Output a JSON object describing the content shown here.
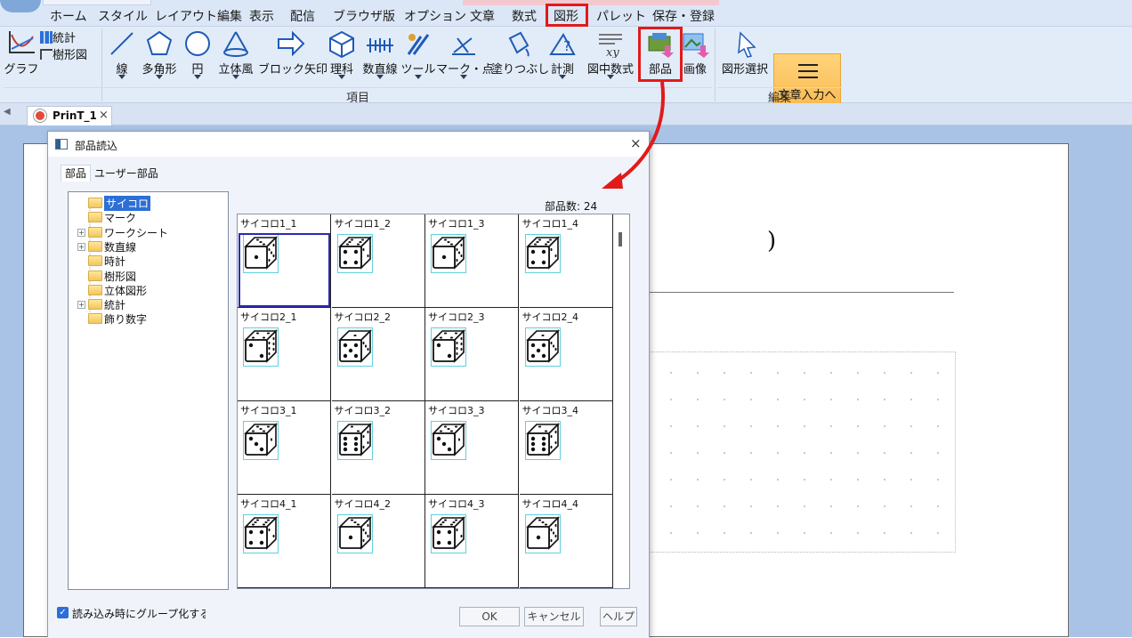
{
  "menubar": {
    "items": [
      "ホーム",
      "スタイル",
      "レイアウト編集",
      "表示",
      "配信",
      "ブラウザ版",
      "オプション",
      "文章",
      "数式",
      "図形",
      "パレット",
      "保存・登録"
    ],
    "highlighted": "図形",
    "highlight_color": "#e21a1a"
  },
  "ribbon": {
    "graph_label": "グラフ",
    "stats_label": "統計",
    "tree_label": "樹形図",
    "buttons": [
      "線",
      "多角形",
      "円",
      "立体風",
      "ブロック矢印",
      "理科",
      "数直線",
      "ツール",
      "マーク・点",
      "塗りつぶし",
      "計測",
      "図中数式",
      "部品",
      "画像",
      "図形選択",
      "文章入力へ"
    ],
    "group_items_label": "項目",
    "group_edit_label": "編集",
    "highlighted_button": "部品"
  },
  "doctab": {
    "title": "PrinT_1",
    "close": "×"
  },
  "document": {
    "paren": ")"
  },
  "dialog": {
    "title": "部品読込",
    "close": "×",
    "tabs": [
      "部品",
      "ユーザー部品"
    ],
    "tree": [
      {
        "label": "サイコロ",
        "selected": true,
        "expandable": false
      },
      {
        "label": "マーク",
        "selected": false,
        "expandable": false
      },
      {
        "label": "ワークシート",
        "selected": false,
        "expandable": true
      },
      {
        "label": "数直線",
        "selected": false,
        "expandable": true
      },
      {
        "label": "時計",
        "selected": false,
        "expandable": false
      },
      {
        "label": "樹形図",
        "selected": false,
        "expandable": false
      },
      {
        "label": "立体図形",
        "selected": false,
        "expandable": false
      },
      {
        "label": "統計",
        "selected": false,
        "expandable": true
      },
      {
        "label": "飾り数字",
        "selected": false,
        "expandable": false
      }
    ],
    "count_label": "部品数:",
    "count_value": "24",
    "parts": [
      "サイコロ1_1",
      "サイコロ1_2",
      "サイコロ1_3",
      "サイコロ1_4",
      "サイコロ2_1",
      "サイコロ2_2",
      "サイコロ2_3",
      "サイコロ2_4",
      "サイコロ3_1",
      "サイコロ3_2",
      "サイコロ3_3",
      "サイコロ3_4",
      "サイコロ4_1",
      "サイコロ4_2",
      "サイコロ4_3",
      "サイコロ4_4"
    ],
    "selected_part": "サイコロ1_1",
    "group_checkbox_label": "読み込み時にグループ化する",
    "group_checkbox_checked": true,
    "ok_label": "OK",
    "cancel_label": "キャンセル",
    "help_label": "ヘルプ"
  },
  "icons": [
    "graph-icon",
    "stats-icon",
    "tree-icon",
    "line-icon",
    "polygon-icon",
    "circle-icon",
    "solid-icon",
    "block-arrow-icon",
    "science-icon",
    "number-line-icon",
    "tool-icon",
    "mark-icon",
    "fill-icon",
    "measure-icon",
    "formula-icon",
    "parts-icon",
    "image-icon",
    "select-icon",
    "text-input-icon",
    "folder-icon",
    "dice-icon",
    "annotation-arrow-icon"
  ]
}
